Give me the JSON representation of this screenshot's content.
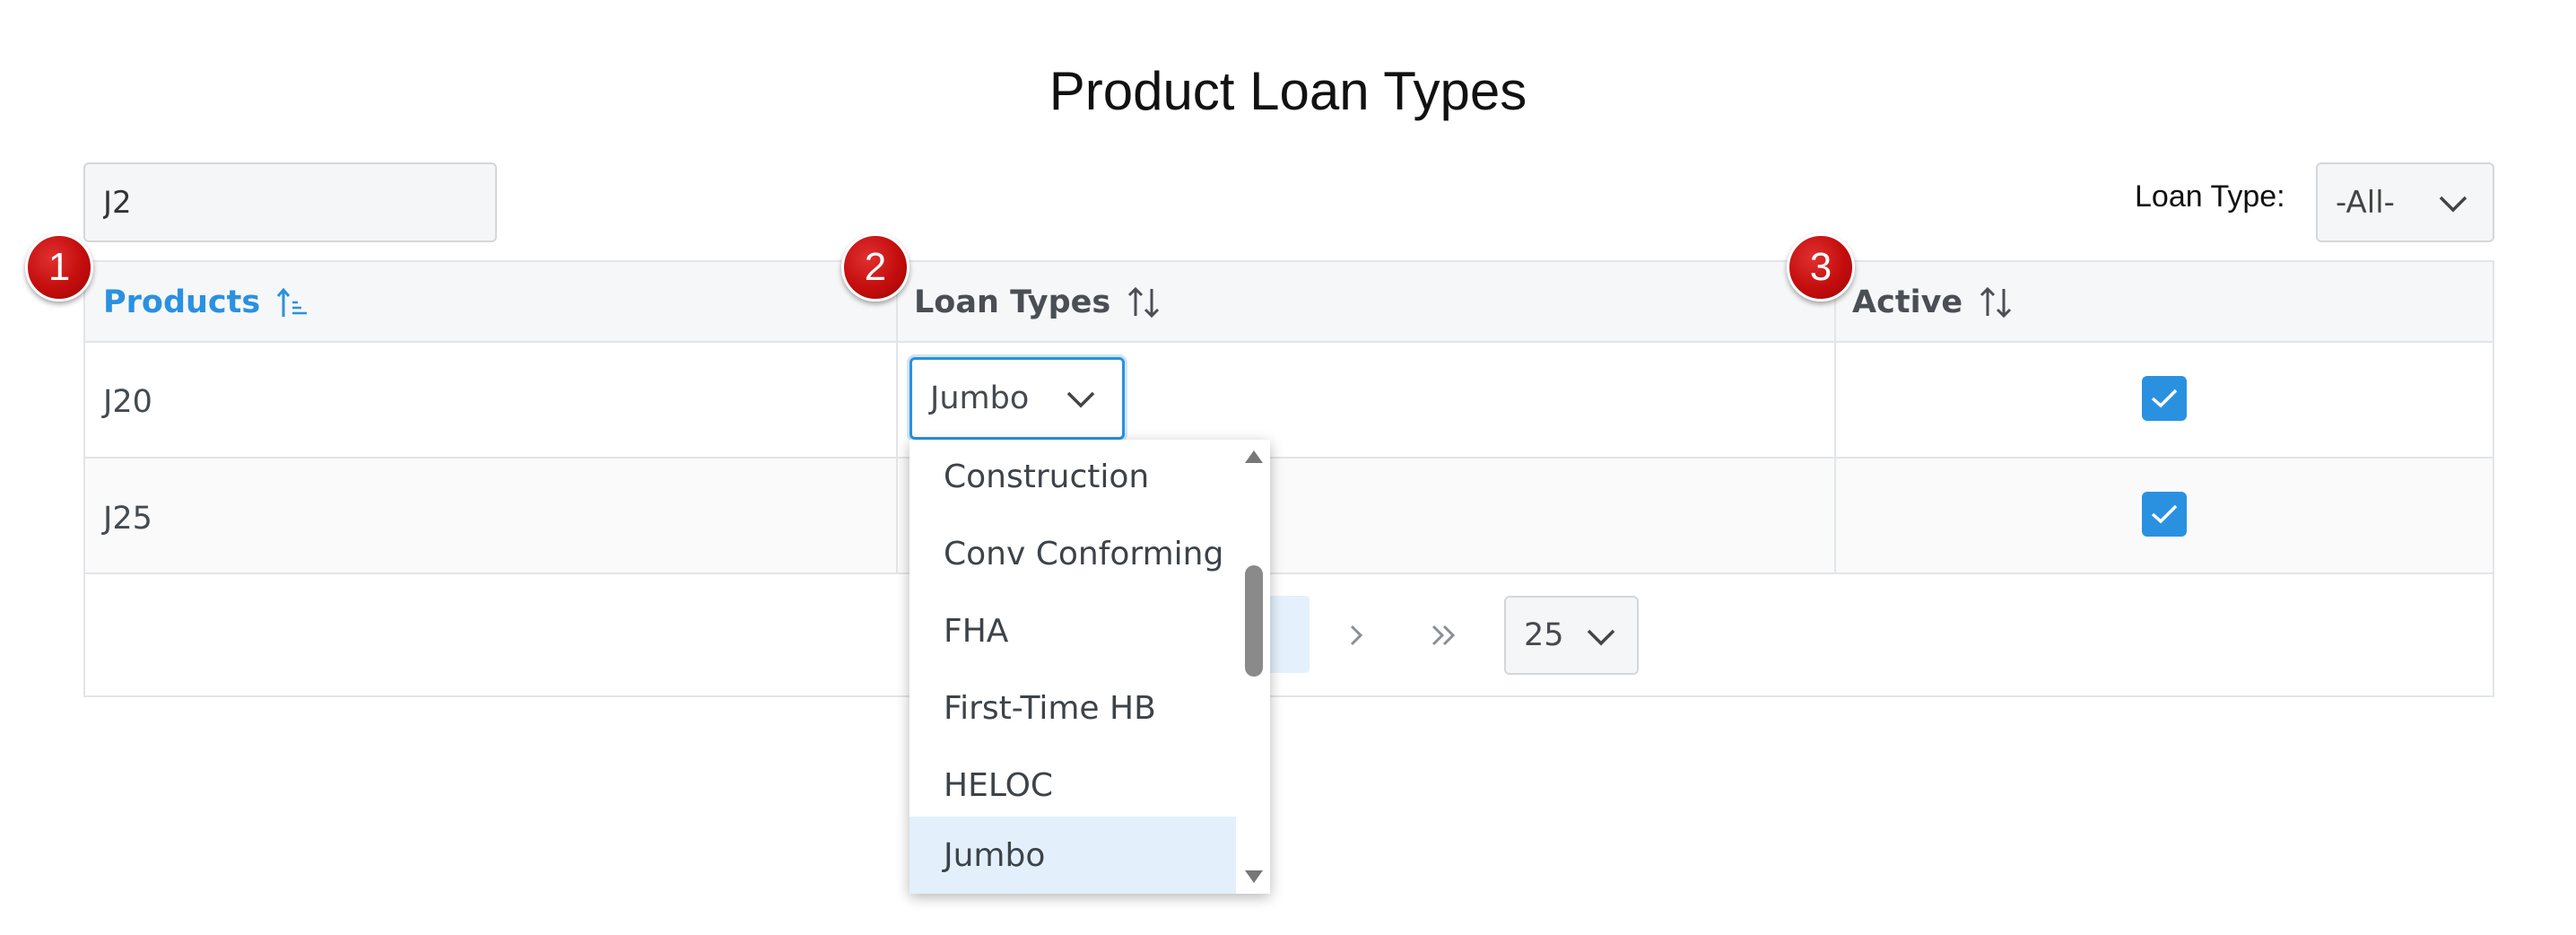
{
  "page": {
    "title": "Product Loan Types"
  },
  "filter": {
    "search_value": "J2",
    "loan_type_label": "Loan Type:",
    "loan_type_value": "-All-"
  },
  "grid": {
    "columns": [
      {
        "label": "Products",
        "sort": "ascending"
      },
      {
        "label": "Loan Types",
        "sort": "none"
      },
      {
        "label": "Active",
        "sort": "none"
      }
    ],
    "rows": [
      {
        "product": "J20",
        "loan_type": "Jumbo",
        "active": true
      },
      {
        "product": "J25",
        "loan_type": "",
        "active": true
      }
    ]
  },
  "dropdown": {
    "options": [
      "Construction",
      "Conv Conforming",
      "FHA",
      "First-Time HB",
      "HELOC",
      "Jumbo"
    ],
    "selected": "Jumbo"
  },
  "pagination": {
    "page_size": "25"
  },
  "callouts": [
    "1",
    "2",
    "3"
  ],
  "colors": {
    "accent": "#2a91e0",
    "callout": "#c40d0d",
    "selected_option_bg": "#e3f0fc"
  }
}
